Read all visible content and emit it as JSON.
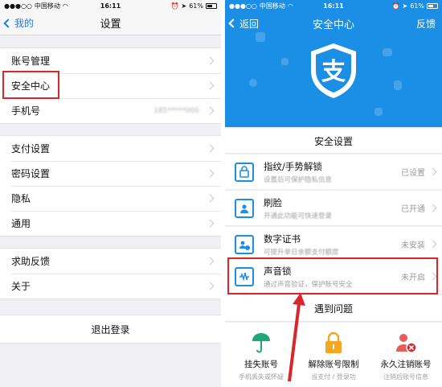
{
  "left": {
    "status": {
      "carrier": "中国移动",
      "time": "16:11",
      "battery": "61%"
    },
    "nav": {
      "back_label": "我的",
      "title": "设置"
    },
    "group1": [
      {
        "label": "账号管理",
        "value": ""
      },
      {
        "label": "安全中心",
        "value": ""
      },
      {
        "label": "手机号",
        "value": "185*****000"
      }
    ],
    "group2": [
      {
        "label": "支付设置"
      },
      {
        "label": "密码设置"
      },
      {
        "label": "隐私"
      },
      {
        "label": "通用"
      }
    ],
    "group3": [
      {
        "label": "求助反馈"
      },
      {
        "label": "关于"
      }
    ],
    "logout_label": "退出登录"
  },
  "right": {
    "status": {
      "carrier": "中国移动",
      "time": "16:11",
      "battery": "61%"
    },
    "nav": {
      "back_label": "返回",
      "title": "安全中心",
      "right_label": "反馈"
    },
    "shield_glyph": "支",
    "section_title": "安全设置",
    "items": [
      {
        "icon": "fingerprint-icon",
        "title": "指纹/手势解锁",
        "subtitle": "设置后可保护隐私信息",
        "status": "已设置"
      },
      {
        "icon": "face-scan-icon",
        "title": "刷脸",
        "subtitle": "开通此功能可快速登录",
        "status": "已开通"
      },
      {
        "icon": "certificate-icon",
        "title": "数字证书",
        "subtitle": "可提升单日余额支付额度",
        "status": "未安装"
      },
      {
        "icon": "voiceprint-icon",
        "title": "声音锁",
        "subtitle": "通过声音验证，保护账号安全",
        "status": "未开启"
      }
    ],
    "help_title": "遇到问题",
    "help_items": [
      {
        "icon": "umbrella-icon",
        "title": "挂失账号",
        "subtitle": "手机丢失或怀疑"
      },
      {
        "icon": "lock-icon",
        "title": "解除账号限制",
        "subtitle": "当支付 / 登录功"
      },
      {
        "icon": "user-remove-icon",
        "title": "永久注销账号",
        "subtitle": "注销后账号信息"
      }
    ]
  },
  "colors": {
    "accent": "#1b8fe6",
    "highlight": "#d9262b",
    "ios_blue": "#1a7cf4"
  }
}
